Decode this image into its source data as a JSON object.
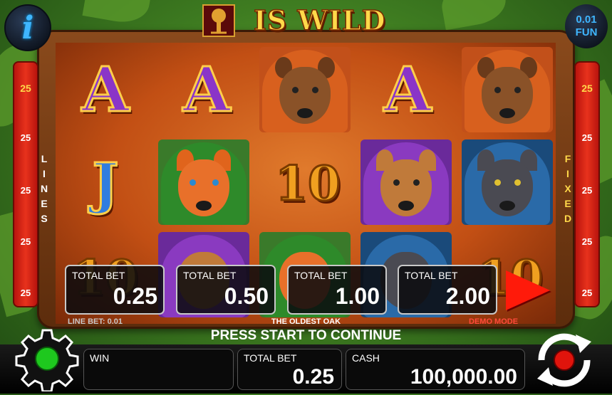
{
  "header": {
    "info_icon": "i",
    "title": "IS WILD",
    "coin_value": "0.01",
    "coin_mode": "FUN"
  },
  "reels": [
    [
      "letter-A",
      "letter-J",
      "letter-10"
    ],
    [
      "letter-A",
      "fox-robin-hood",
      "deer-purple-hood"
    ],
    [
      "bear-orange-hood",
      "letter-10",
      "fox-robin-hood"
    ],
    [
      "letter-A",
      "deer-purple-hood",
      "wolf-blue-hood"
    ],
    [
      "bear-orange-hood",
      "wolf-blue-hood",
      "letter-10"
    ]
  ],
  "symbols": {
    "letter_A": "A",
    "letter_J": "J",
    "letter_10": "10"
  },
  "lines_left": {
    "label_letters": [
      "L",
      "I",
      "N",
      "E",
      "S"
    ],
    "values": [
      "25",
      "25",
      "25",
      "25",
      "25"
    ]
  },
  "lines_right": {
    "label_letters": [
      "F",
      "I",
      "X",
      "E",
      "D"
    ],
    "values": [
      "25",
      "25",
      "25",
      "25",
      "25"
    ]
  },
  "bet_options": [
    {
      "label": "TOTAL BET",
      "value": "0.25"
    },
    {
      "label": "TOTAL BET",
      "value": "0.50"
    },
    {
      "label": "TOTAL BET",
      "value": "1.00"
    },
    {
      "label": "TOTAL BET",
      "value": "2.00"
    }
  ],
  "info": {
    "line_bet": "LINE BET: 0.01",
    "game_name": "THE OLDEST OAK",
    "demo_mode": "DEMO MODE",
    "message": "PRESS START TO CONTINUE"
  },
  "bottom": {
    "win_label": "WIN",
    "win_value": "",
    "total_bet_label": "TOTAL BET",
    "total_bet_value": "0.25",
    "cash_label": "CASH",
    "cash_value": "100,000.00"
  },
  "colors": {
    "line_panel": "#e8321c",
    "left_label": "#ffffff",
    "right_label": "#ffd84a",
    "play_arrow": "#ff1a0a",
    "info_blue": "#3fb6ff",
    "demo_mode": "#ff4a3a",
    "line_bet": "#c8c8c8"
  }
}
